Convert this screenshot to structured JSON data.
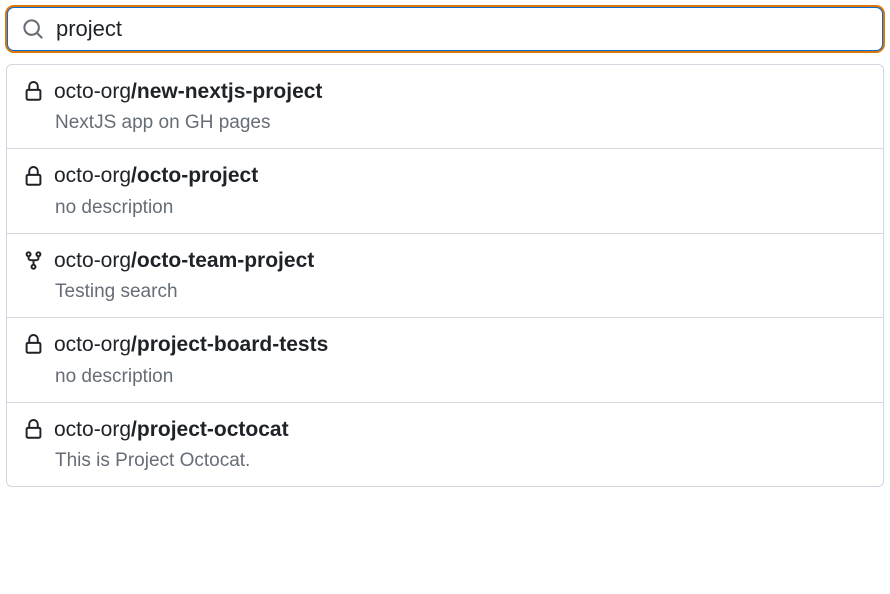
{
  "search": {
    "value": "project",
    "placeholder": ""
  },
  "results": [
    {
      "icon": "lock-icon",
      "owner": "octo-org",
      "repo": "new-nextjs-project",
      "description": "NextJS app on GH pages"
    },
    {
      "icon": "lock-icon",
      "owner": "octo-org",
      "repo": "octo-project",
      "description": "no description"
    },
    {
      "icon": "fork-icon",
      "owner": "octo-org",
      "repo": "octo-team-project",
      "description": "Testing search"
    },
    {
      "icon": "lock-icon",
      "owner": "octo-org",
      "repo": "project-board-tests",
      "description": "no description"
    },
    {
      "icon": "lock-icon",
      "owner": "octo-org",
      "repo": "project-octocat",
      "description": "This is Project Octocat."
    }
  ]
}
